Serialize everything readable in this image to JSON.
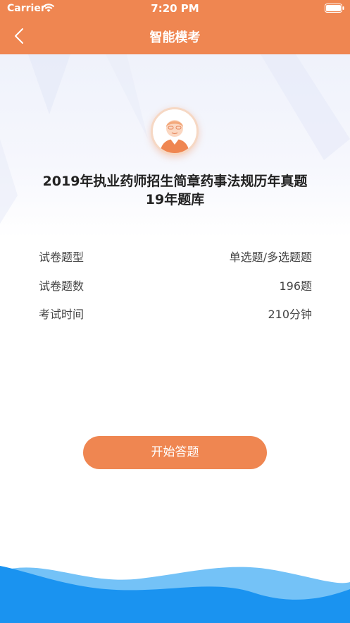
{
  "status_bar": {
    "carrier": "Carrier",
    "time": "7:20 PM"
  },
  "nav": {
    "title": "智能模考",
    "back_icon": "chevron-left-icon"
  },
  "exam": {
    "title_line1": "2019年执业药师招生简章药事法规历年真题",
    "title_line2": "19年题库",
    "details": [
      {
        "label": "试卷题型",
        "value": "单选题/多选题题"
      },
      {
        "label": "试卷题数",
        "value": "196题"
      },
      {
        "label": "考试时间",
        "value": "210分钟"
      }
    ]
  },
  "actions": {
    "start_label": "开始答题"
  },
  "colors": {
    "accent": "#ef8651",
    "wave_dark": "#1a93f0",
    "wave_light": "#74c2f7"
  }
}
